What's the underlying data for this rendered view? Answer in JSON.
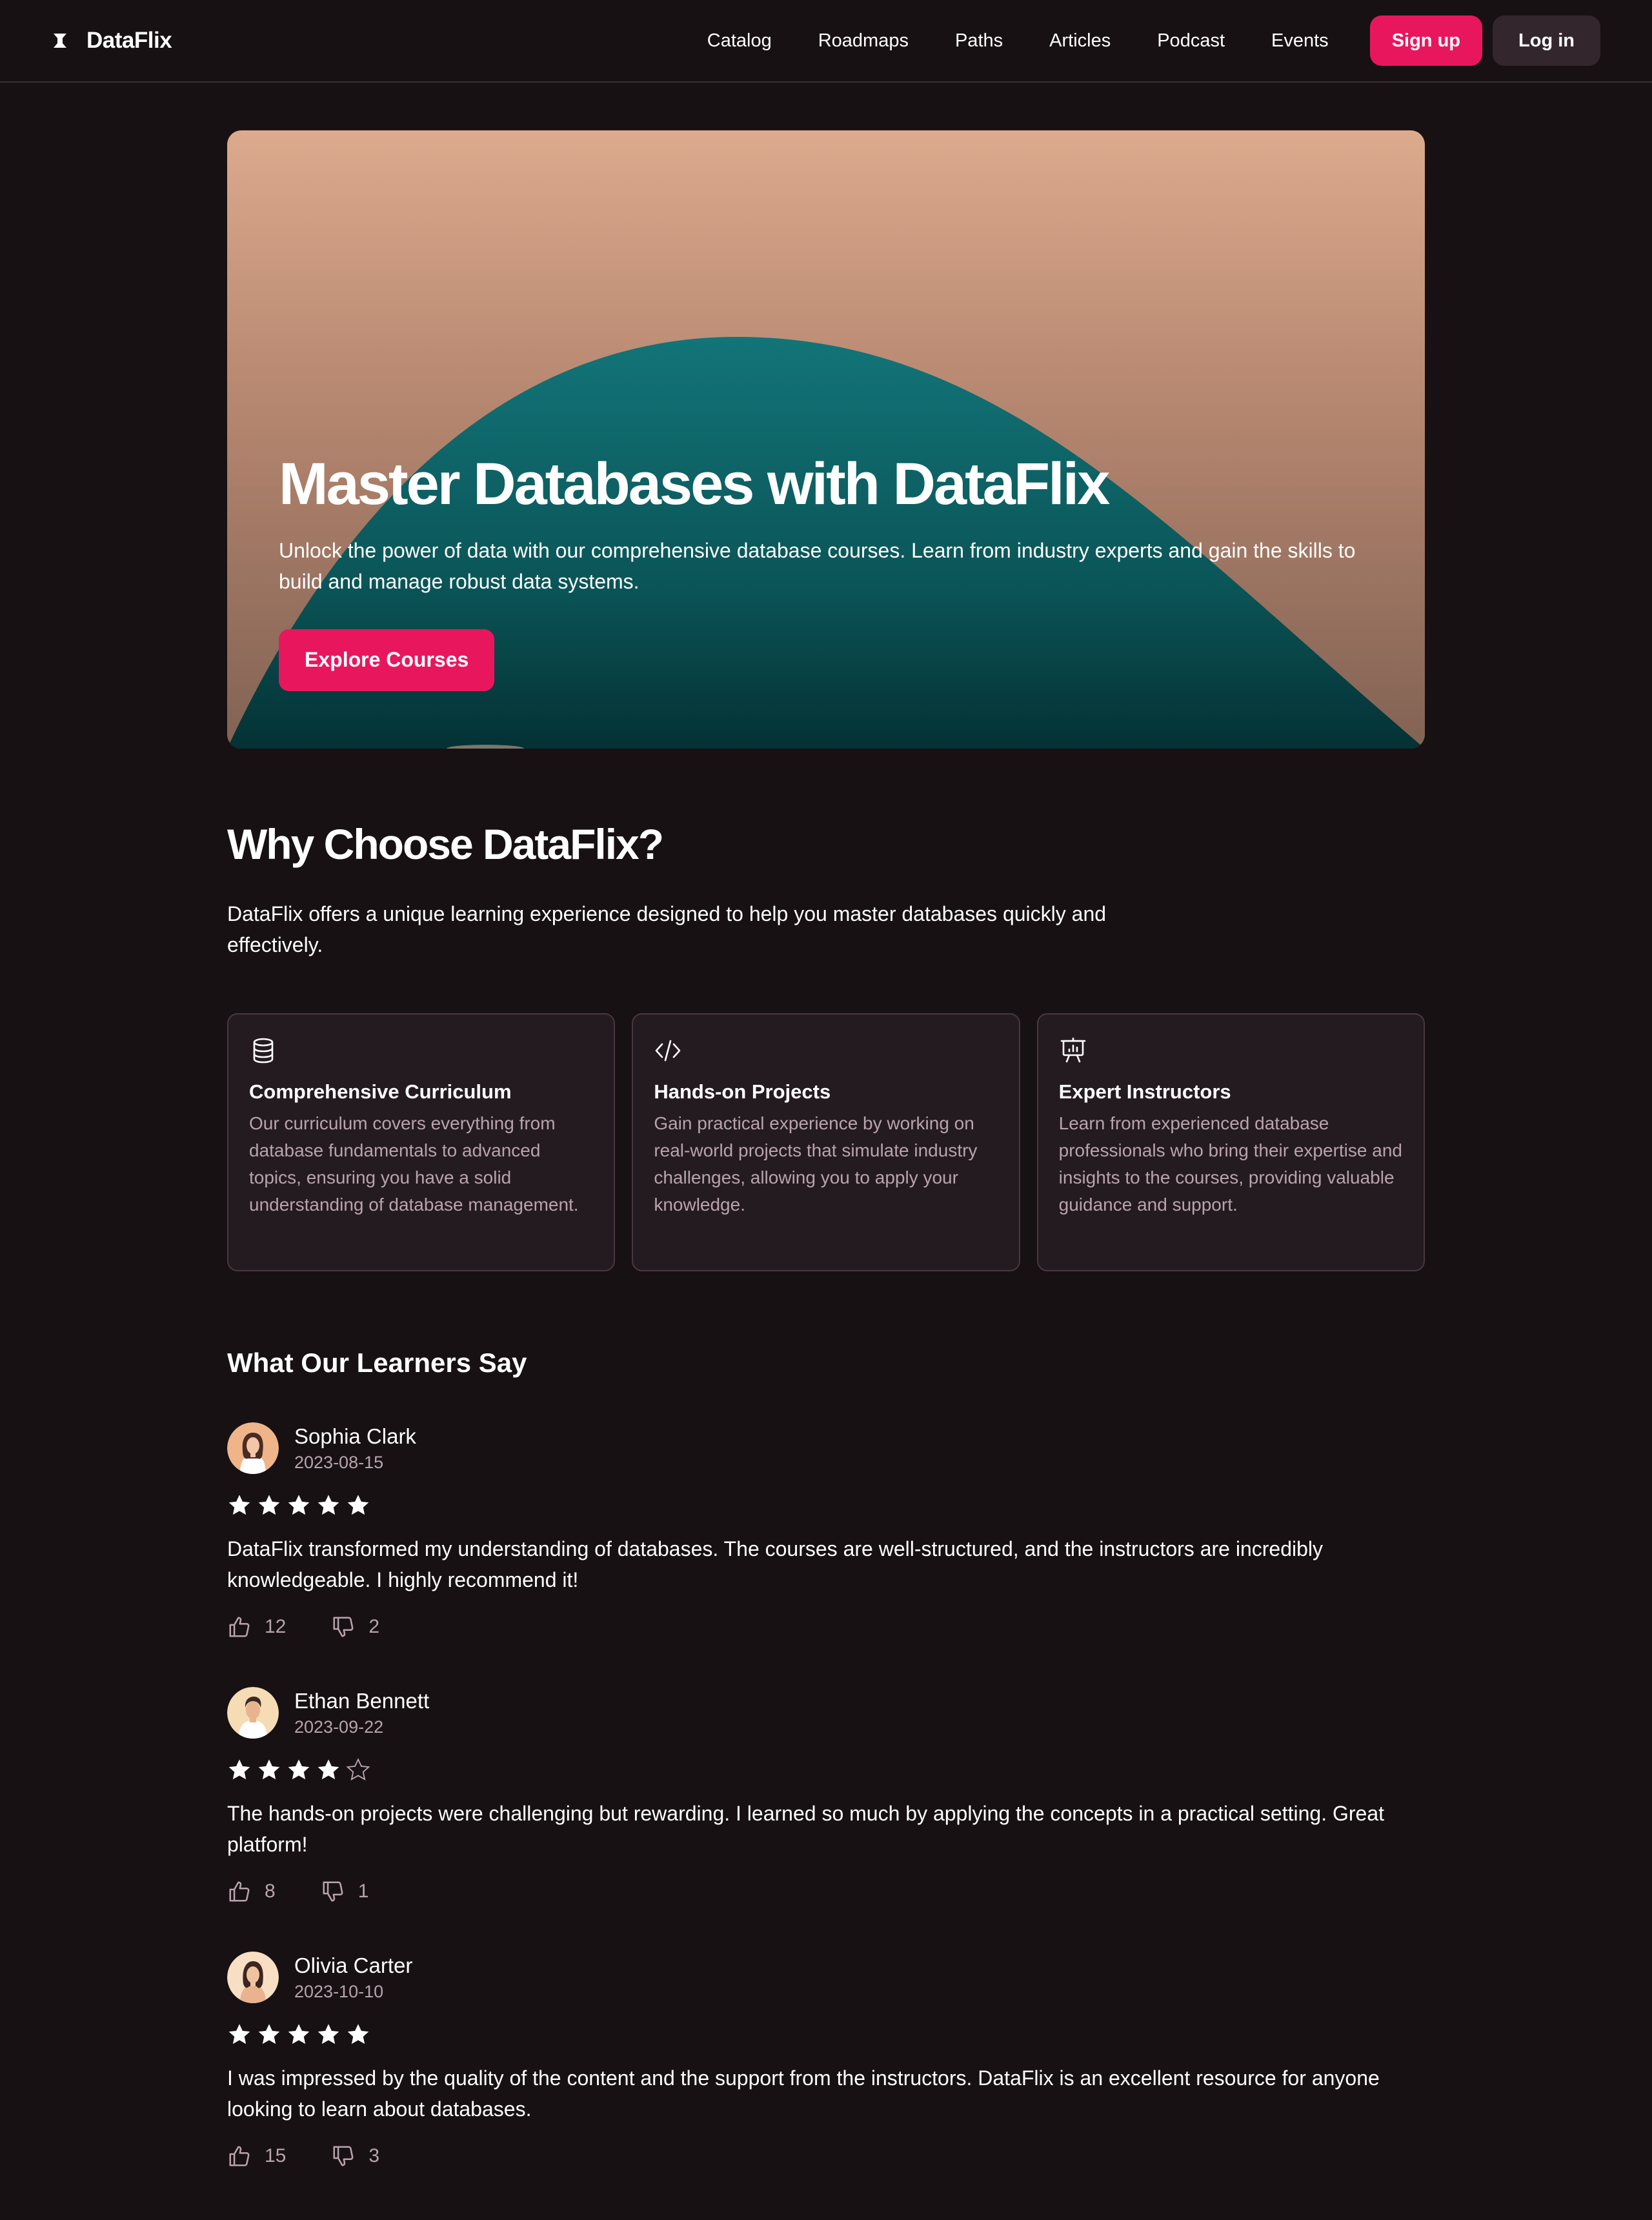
{
  "brand": {
    "name": "DataFlix",
    "logo_icon": "hourglass-logo-icon"
  },
  "nav": {
    "links": [
      "Catalog",
      "Roadmaps",
      "Paths",
      "Articles",
      "Podcast",
      "Events"
    ],
    "signup_label": "Sign up",
    "login_label": "Log in"
  },
  "hero": {
    "title": "Master Databases with DataFlix",
    "subtitle": "Unlock the power of data with our comprehensive database courses. Learn from industry experts and gain the skills to build and manage robust data systems.",
    "cta_label": "Explore Courses"
  },
  "why": {
    "title": "Why Choose DataFlix?",
    "description": "DataFlix offers a unique learning experience designed to help you master databases quickly and effectively.",
    "features": [
      {
        "icon": "database-icon",
        "title": "Comprehensive Curriculum",
        "text": "Our curriculum covers everything from database fundamentals to advanced topics, ensuring you have a solid understanding of database management."
      },
      {
        "icon": "code-icon",
        "title": "Hands-on Projects",
        "text": "Gain practical experience by working on real-world projects that simulate industry challenges, allowing you to apply your knowledge."
      },
      {
        "icon": "presentation-icon",
        "title": "Expert Instructors",
        "text": "Learn from experienced database professionals who bring their expertise and insights to the courses, providing valuable guidance and support."
      }
    ]
  },
  "reviews": {
    "title": "What Our Learners Say",
    "items": [
      {
        "name": "Sophia Clark",
        "date": "2023-08-15",
        "rating": 5,
        "text": "DataFlix transformed my understanding of databases. The courses are well-structured, and the instructors are incredibly knowledgeable. I highly recommend it!",
        "likes": "12",
        "dislikes": "2"
      },
      {
        "name": "Ethan Bennett",
        "date": "2023-09-22",
        "rating": 4,
        "text": "The hands-on projects were challenging but rewarding. I learned so much by applying the concepts in a practical setting. Great platform!",
        "likes": "8",
        "dislikes": "1"
      },
      {
        "name": "Olivia Carter",
        "date": "2023-10-10",
        "rating": 5,
        "text": "I was impressed by the quality of the content and the support from the instructors. DataFlix is an excellent resource for anyone looking to learn about databases.",
        "likes": "15",
        "dislikes": "3"
      }
    ]
  },
  "colors": {
    "accent": "#e8175d",
    "background": "#171114",
    "card": "#241b20",
    "muted_text": "#b9a3ac",
    "hero_teal": "#0e6a6e"
  }
}
